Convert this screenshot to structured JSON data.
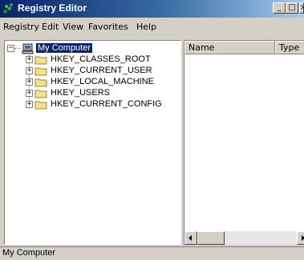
{
  "window": {
    "title": "Registry Editor",
    "icon": "registry-editor-icon",
    "controls": {
      "minimize": "_",
      "maximize": "□",
      "close": "×"
    }
  },
  "menubar": {
    "items": [
      "Registry",
      "Edit",
      "View",
      "Favorites",
      "Help"
    ]
  },
  "tree": {
    "root": {
      "label": "My Computer",
      "icon": "computer-icon",
      "expander": "−",
      "selected": true
    },
    "children": [
      {
        "label": "HKEY_CLASSES_ROOT",
        "icon": "folder-icon",
        "expander": "+"
      },
      {
        "label": "HKEY_CURRENT_USER",
        "icon": "folder-icon",
        "expander": "+"
      },
      {
        "label": "HKEY_LOCAL_MACHINE",
        "icon": "folder-icon",
        "expander": "+"
      },
      {
        "label": "HKEY_USERS",
        "icon": "folder-icon",
        "expander": "+"
      },
      {
        "label": "HKEY_CURRENT_CONFIG",
        "icon": "folder-icon",
        "expander": "+"
      }
    ]
  },
  "list": {
    "columns": [
      "Name",
      "Type"
    ]
  },
  "status": {
    "text": "My Computer"
  },
  "colors": {
    "title_gradient_start": "#0a246a",
    "title_gradient_end": "#a6caf0",
    "selection": "#0a246a",
    "face": "#d4d0c8"
  }
}
